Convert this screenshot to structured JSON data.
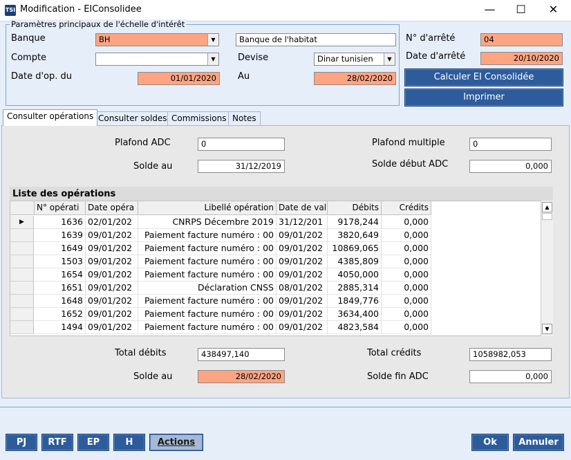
{
  "window": {
    "icon_text": "TSI",
    "title": "Modification - EIConsolidee",
    "controls": {
      "minimize": "—",
      "maximize": "☐",
      "close": "✕"
    }
  },
  "params": {
    "legend": "Paramètres principaux de l'échelle d'intérêt",
    "banque_label": "Banque",
    "banque_value": "BH",
    "banque_name": "Banque de l'habitat",
    "compte_label": "Compte",
    "compte_value": "",
    "devise_label": "Devise",
    "devise_value": "Dinar tunisien",
    "date_du_label": "Date d'op. du",
    "date_du_value": "01/01/2020",
    "au_label": "Au",
    "au_value": "28/02/2020"
  },
  "arrete": {
    "num_label": "N° d'arrêté",
    "num_value": "04",
    "date_label": "Date d'arrêté",
    "date_value": "20/10/2020",
    "calc_button": "Calculer EI Consolidée",
    "print_button": "Imprimer"
  },
  "tabs": [
    {
      "label": "Consulter opérations",
      "active": true
    },
    {
      "label": "Consulter soldes",
      "active": false
    },
    {
      "label": "Commissions",
      "active": false
    },
    {
      "label": "Notes",
      "active": false
    }
  ],
  "top_fields": {
    "plafond_adc_label": "Plafond ADC",
    "plafond_adc_value": "0",
    "plafond_multiple_label": "Plafond multiple",
    "plafond_multiple_value": "0",
    "solde_au_label": "Solde au",
    "solde_au_value": "31/12/2019",
    "solde_debut_label": "Solde début ADC",
    "solde_debut_value": "0,000"
  },
  "grid": {
    "title": "Liste des opérations",
    "columns": [
      "N° opérati",
      "Date opéra",
      "Libellé opération",
      "Date de val",
      "Débits",
      "Crédits"
    ],
    "rows": [
      [
        "1636",
        "02/01/202",
        "CNRPS Décembre 2019",
        "31/12/201",
        "9178,244",
        "0,000"
      ],
      [
        "1639",
        "09/01/202",
        "Paiement facture numéro : 00",
        "09/01/202",
        "3820,649",
        "0,000"
      ],
      [
        "1649",
        "09/01/202",
        "Paiement facture numéro : 00",
        "09/01/202",
        "10869,065",
        "0,000"
      ],
      [
        "1503",
        "09/01/202",
        "Paiement facture numéro : 00",
        "09/01/202",
        "4385,809",
        "0,000"
      ],
      [
        "1654",
        "09/01/202",
        "Paiement facture numéro : 00",
        "09/01/202",
        "4050,000",
        "0,000"
      ],
      [
        "1651",
        "09/01/202",
        "Déclaration CNSS",
        "08/01/202",
        "2885,314",
        "0,000"
      ],
      [
        "1648",
        "09/01/202",
        "Paiement facture numéro : 00",
        "09/01/202",
        "1849,776",
        "0,000"
      ],
      [
        "1652",
        "09/01/202",
        "Paiement facture numéro : 00",
        "09/01/202",
        "3634,400",
        "0,000"
      ],
      [
        "1494",
        "09/01/202",
        "Paiement facture numéro : 00",
        "09/01/202",
        "4823,584",
        "0,000"
      ]
    ],
    "current_row_marker": "▶"
  },
  "totals": {
    "total_debits_label": "Total débits",
    "total_debits_value": "438497,140",
    "total_credits_label": "Total crédits",
    "total_credits_value": "1058982,053",
    "solde_au_label": "Solde au",
    "solde_au_value": "28/02/2020",
    "solde_fin_label": "Solde fin ADC",
    "solde_fin_value": "0,000"
  },
  "footer": {
    "pj": "PJ",
    "rtf": "RTF",
    "ep": "EP",
    "h": "H",
    "actions": "Actions",
    "ok": "Ok",
    "annuler": "Annuler"
  },
  "colors": {
    "accent_blue": "#2d5c9c",
    "required_orange": "#fda583",
    "panel_bg": "#e6eefa"
  }
}
